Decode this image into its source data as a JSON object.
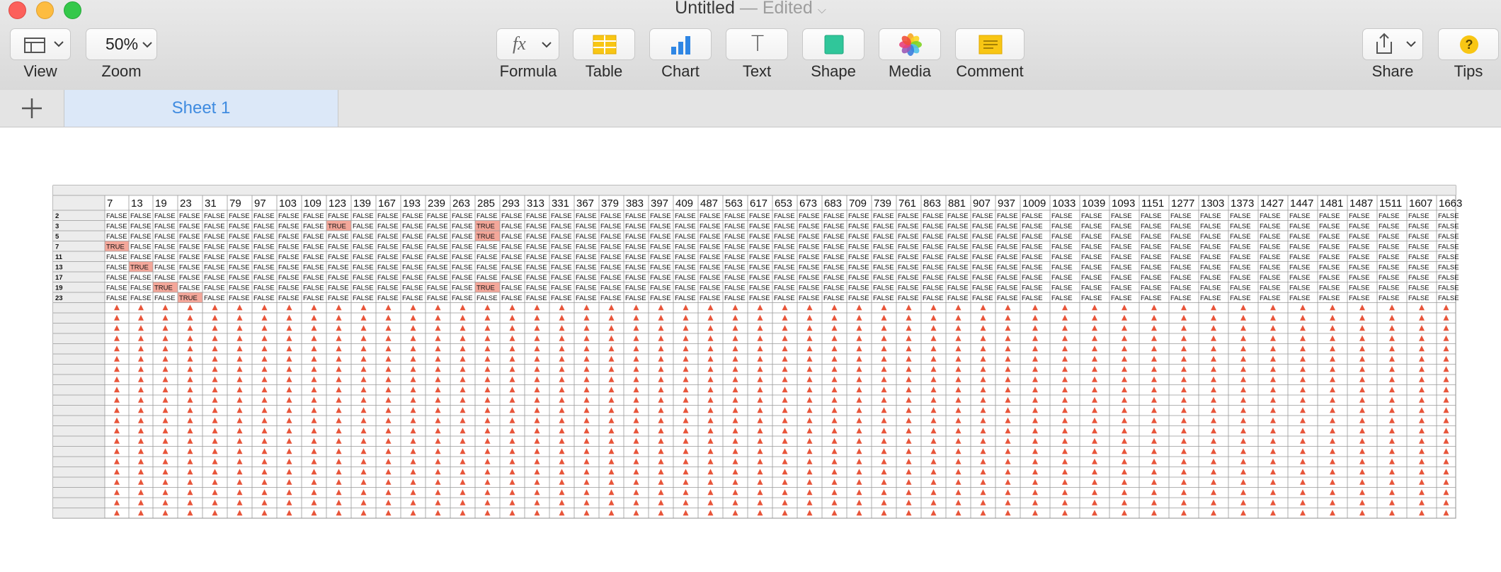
{
  "window": {
    "title": "Untitled",
    "status": "— Edited"
  },
  "toolbar": {
    "view_label": "View",
    "zoom_value": "50%",
    "zoom_label": "Zoom",
    "formula_icon_text": "fx",
    "formula_label": "Formula",
    "table_label": "Table",
    "chart_label": "Chart",
    "text_icon_text": "T",
    "text_label": "Text",
    "shape_label": "Shape",
    "media_label": "Media",
    "comment_label": "Comment",
    "share_label": "Share",
    "tips_icon_text": "?",
    "tips_label": "Tips"
  },
  "tabs": {
    "sheet1_label": "Sheet 1"
  },
  "colors": {
    "true_fill": "#f4a79a",
    "error_triangle": "#e8553a",
    "selected_tab": "#dce8f8",
    "accent": "#3f8be0"
  },
  "table": {
    "columns": [
      "7",
      "13",
      "19",
      "23",
      "31",
      "79",
      "97",
      "103",
      "109",
      "123",
      "139",
      "167",
      "193",
      "239",
      "263",
      "285",
      "293",
      "313",
      "331",
      "367",
      "379",
      "383",
      "397",
      "409",
      "487",
      "563",
      "617",
      "653",
      "673",
      "683",
      "709",
      "739",
      "761",
      "863",
      "881",
      "907",
      "937",
      "1009",
      "1033",
      "1039",
      "1093",
      "1151",
      "1277",
      "1303",
      "1373",
      "1427",
      "1447",
      "1481",
      "1487",
      "1511",
      "1607",
      "1663"
    ],
    "row_labels": [
      "2",
      "3",
      "5",
      "7",
      "11",
      "13",
      "17",
      "19",
      "23"
    ],
    "false_text": "FALSE",
    "true_text": "TRUE",
    "true_cells": [
      [
        1,
        9
      ],
      [
        1,
        15
      ],
      [
        2,
        15
      ],
      [
        3,
        0
      ],
      [
        5,
        1
      ],
      [
        7,
        2
      ],
      [
        7,
        15
      ],
      [
        8,
        3
      ]
    ],
    "error_rows": 21,
    "error_icon": "warning-triangle"
  }
}
